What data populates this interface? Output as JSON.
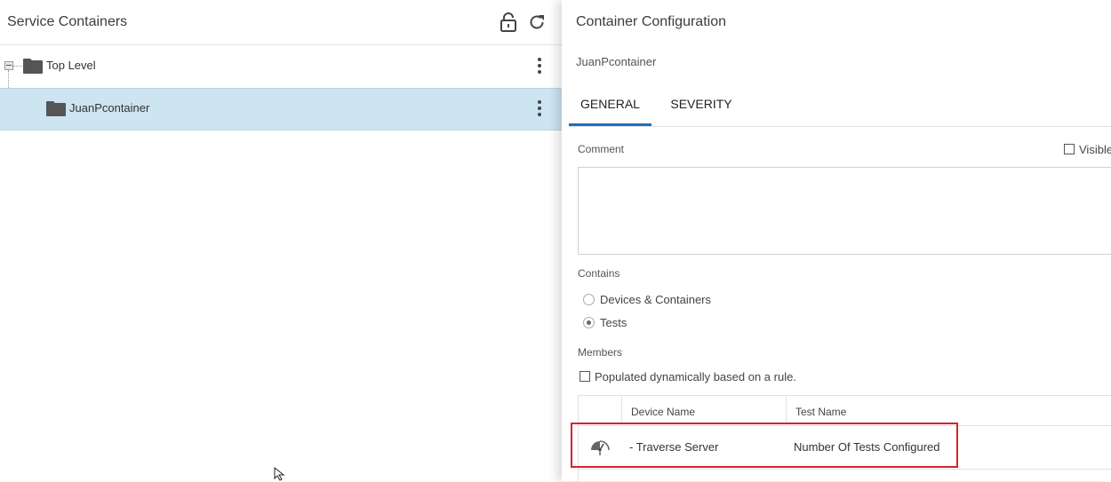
{
  "left_panel": {
    "title": "Service Containers",
    "tree": [
      {
        "label": "Top Level",
        "expanded": true,
        "selected": false
      },
      {
        "label": "JuanPcontainer",
        "selected": true
      }
    ]
  },
  "right_panel": {
    "title": "Container Configuration",
    "subtitle": "JuanPcontainer",
    "tabs": [
      {
        "label": "GENERAL",
        "active": true
      },
      {
        "label": "SEVERITY",
        "active": false
      }
    ],
    "comment_label": "Comment",
    "visible_label": "Visible",
    "contains_label": "Contains",
    "contains_options": [
      {
        "label": "Devices & Containers",
        "checked": false
      },
      {
        "label": "Tests",
        "checked": true
      }
    ],
    "members_label": "Members",
    "dynamic_label": "Populated dynamically based on a rule.",
    "grid": {
      "columns": [
        "Device Name",
        "Test Name"
      ],
      "rows": [
        {
          "icon": "gauge-icon",
          "device": "- Traverse Server",
          "test": "Number Of Tests Configured"
        }
      ]
    }
  },
  "colors": {
    "selected_row": "#cde4f1",
    "tab_underline": "#1d6fb8",
    "highlight_box": "#d8232a"
  }
}
